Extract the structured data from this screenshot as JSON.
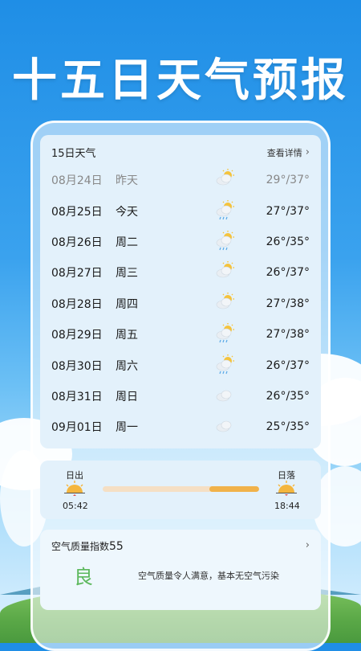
{
  "hero": {
    "title": "十五日天气预报"
  },
  "forecast": {
    "title": "15日天气",
    "more_label": "查看详情",
    "rows": [
      {
        "date": "08月24日",
        "day": "昨天",
        "icon": "partly-cloudy-icon",
        "temp": "29°/37°",
        "past": true
      },
      {
        "date": "08月25日",
        "day": "今天",
        "icon": "sun-rain-icon",
        "temp": "27°/37°",
        "past": false
      },
      {
        "date": "08月26日",
        "day": "周二",
        "icon": "sun-rain-icon",
        "temp": "26°/35°",
        "past": false
      },
      {
        "date": "08月27日",
        "day": "周三",
        "icon": "partly-cloudy-icon",
        "temp": "26°/37°",
        "past": false
      },
      {
        "date": "08月28日",
        "day": "周四",
        "icon": "partly-cloudy-icon",
        "temp": "27°/38°",
        "past": false
      },
      {
        "date": "08月29日",
        "day": "周五",
        "icon": "sun-rain-icon",
        "temp": "27°/38°",
        "past": false
      },
      {
        "date": "08月30日",
        "day": "周六",
        "icon": "sun-rain-icon",
        "temp": "26°/37°",
        "past": false
      },
      {
        "date": "08月31日",
        "day": "周日",
        "icon": "cloudy-icon",
        "temp": "26°/35°",
        "past": false
      },
      {
        "date": "09月01日",
        "day": "周一",
        "icon": "cloudy-icon",
        "temp": "25°/35°",
        "past": false
      }
    ]
  },
  "sun": {
    "sunrise_label": "日出",
    "sunrise_time": "05:42",
    "sunset_label": "日落",
    "sunset_time": "18:44",
    "progress": 0.68
  },
  "aqi": {
    "title": "空气质量指数",
    "value": "55",
    "level": "良",
    "description": "空气质量令人满意，基本无空气污染"
  },
  "colors": {
    "accent": "#f1b24a",
    "good": "#5cb85c"
  }
}
